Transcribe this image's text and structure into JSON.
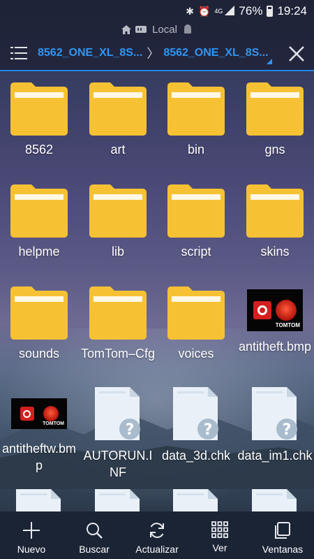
{
  "status_bar": {
    "network": "4G",
    "battery": "76%",
    "time": "19:24"
  },
  "location_bar": {
    "label": "Local"
  },
  "path_bar": {
    "segments": [
      "8562_ONE_XL_8S...",
      "8562_ONE_XL_8S..."
    ],
    "accent_color": "#2f96f3"
  },
  "files": [
    {
      "name": "8562",
      "type": "folder"
    },
    {
      "name": "art",
      "type": "folder"
    },
    {
      "name": "bin",
      "type": "folder"
    },
    {
      "name": "gns",
      "type": "folder"
    },
    {
      "name": "helpme",
      "type": "folder"
    },
    {
      "name": "lib",
      "type": "folder"
    },
    {
      "name": "script",
      "type": "folder"
    },
    {
      "name": "skins",
      "type": "folder"
    },
    {
      "name": "sounds",
      "type": "folder"
    },
    {
      "name": "TomTom–Cfg",
      "type": "folder"
    },
    {
      "name": "voices",
      "type": "folder"
    },
    {
      "name": "antitheft.bmp",
      "type": "bmp"
    },
    {
      "name": "antitheftw.bmp",
      "type": "bmp"
    },
    {
      "name": "AUTORUN.INF",
      "type": "unknown"
    },
    {
      "name": "data_3d.chk",
      "type": "unknown"
    },
    {
      "name": "data_im1.chk",
      "type": "unknown"
    },
    {
      "name": "",
      "type": "unknown"
    },
    {
      "name": "",
      "type": "unknown"
    },
    {
      "name": "",
      "type": "unknown"
    },
    {
      "name": "",
      "type": "unknown"
    }
  ],
  "file_labels": {
    "l0": "8562",
    "l1": "art",
    "l2": "bin",
    "l3": "gns",
    "l4": "helpme",
    "l5": "lib",
    "l6": "script",
    "l7": "skins",
    "l8": "sounds",
    "l9": "TomTom–Cfg",
    "l10": "voices",
    "l11": "antitheft.bmp",
    "l12": "antitheftw.bmp",
    "l13": "AUTORUN.INF",
    "l14": "data_3d.chk",
    "l15": "data_im1.chk"
  },
  "bmp_thumbnail": {
    "brand": "TOMTOM"
  },
  "toolbar": {
    "new_label": "Nuevo",
    "search_label": "Buscar",
    "refresh_label": "Actualizar",
    "view_label": "Ver",
    "windows_label": "Ventanas"
  },
  "colors": {
    "folder": "#f6c234",
    "folder_tab": "#f0b429",
    "toolbar_bg": "#1b2435"
  }
}
